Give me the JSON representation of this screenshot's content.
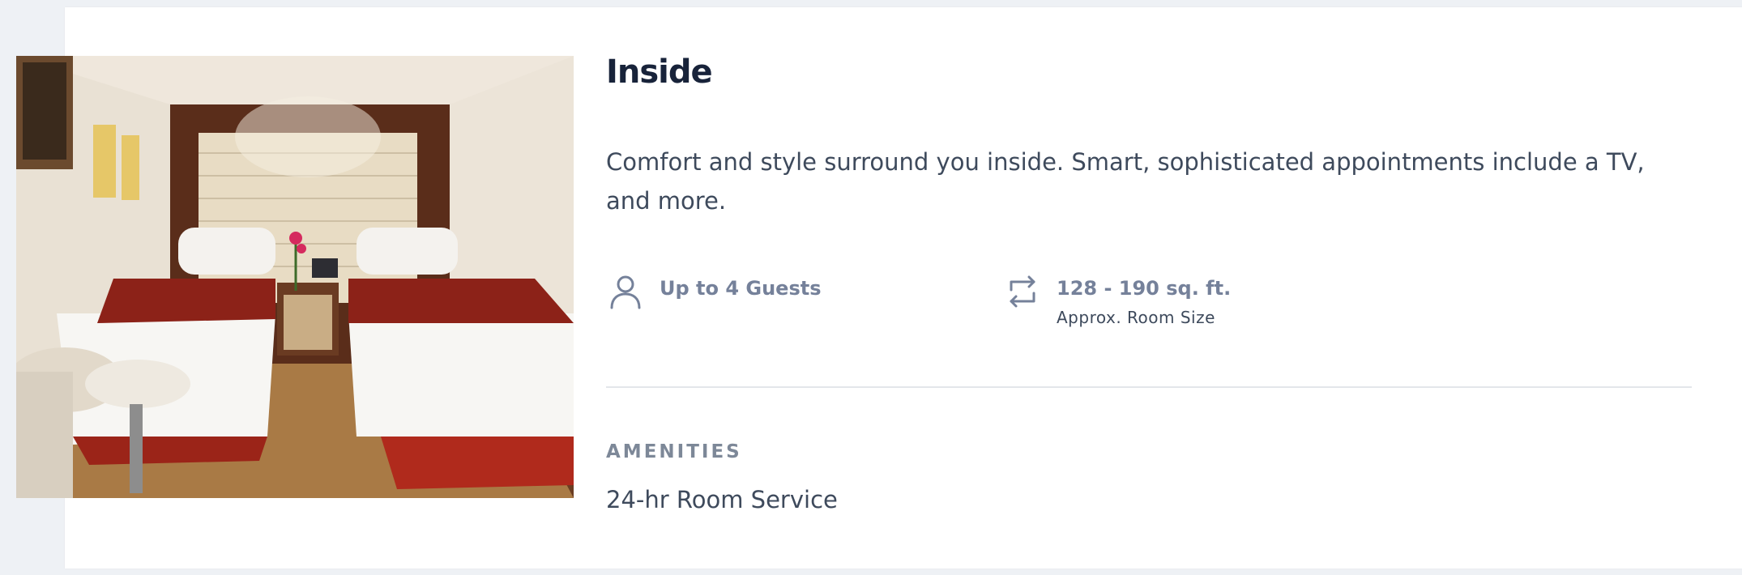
{
  "room": {
    "title": "Inside",
    "description": "Comfort and style surround you inside. Smart, sophisticated appointments include a TV, and more.",
    "photo_alt": "Inside stateroom with two twin beds"
  },
  "features": {
    "guests": {
      "icon": "person-icon",
      "label": "Up to 4 Guests"
    },
    "size": {
      "icon": "resize-arrows-icon",
      "label": "128 - 190 sq. ft.",
      "sublabel": "Approx. Room Size"
    }
  },
  "amenities": {
    "heading": "AMENITIES",
    "items": [
      "24-hr Room Service"
    ]
  },
  "colors": {
    "title": "#18233a",
    "body_text": "#3e4a5c",
    "muted_label": "#75819a",
    "divider": "#e3e6ea",
    "page_bg": "#eef1f5"
  }
}
